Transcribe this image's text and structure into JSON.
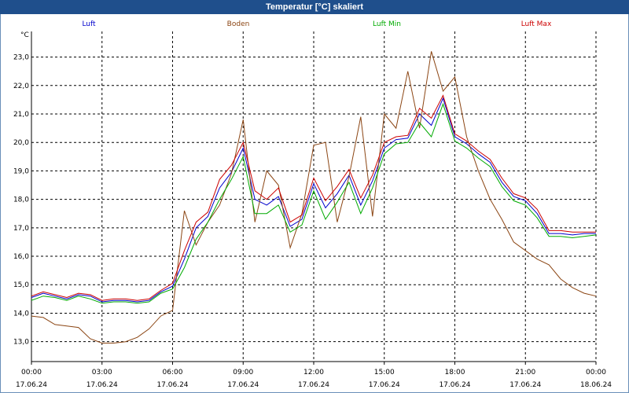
{
  "window": {
    "title": "Temperatur [°C] skaliert"
  },
  "chart_data": {
    "type": "line",
    "title": "Temperatur [°C] skaliert",
    "ylabel": "°C",
    "xlabel": "",
    "ylim": [
      12.3,
      23.9
    ],
    "yticks": [
      13.0,
      14.0,
      15.0,
      16.0,
      17.0,
      18.0,
      19.0,
      20.0,
      21.0,
      22.0,
      23.0
    ],
    "ytick_labels": [
      "13,0",
      "14,0",
      "15,0",
      "16,0",
      "17,0",
      "18,0",
      "19,0",
      "20,0",
      "21,0",
      "22,0",
      "23,0"
    ],
    "xlim": [
      0,
      24
    ],
    "xticks": [
      0,
      3,
      6,
      9,
      12,
      15,
      18,
      21,
      24
    ],
    "xtick_labels": [
      [
        "00:00",
        "17.06.24"
      ],
      [
        "03:00",
        "17.06.24"
      ],
      [
        "06:00",
        "17.06.24"
      ],
      [
        "09:00",
        "17.06.24"
      ],
      [
        "12:00",
        "17.06.24"
      ],
      [
        "15:00",
        "17.06.24"
      ],
      [
        "18:00",
        "17.06.24"
      ],
      [
        "21:00",
        "17.06.24"
      ],
      [
        "00:00",
        "18.06.24"
      ]
    ],
    "grid": true,
    "legend_position": "top",
    "x": [
      0,
      0.5,
      1,
      1.5,
      2,
      2.5,
      3,
      3.5,
      4,
      4.5,
      5,
      5.5,
      6,
      6.5,
      7,
      7.5,
      8,
      8.5,
      9,
      9.5,
      10,
      10.5,
      11,
      11.5,
      12,
      12.5,
      13,
      13.5,
      14,
      14.5,
      15,
      15.5,
      16,
      16.5,
      17,
      17.5,
      18,
      18.5,
      19,
      19.5,
      20,
      20.5,
      21,
      21.5,
      22,
      22.5,
      23,
      23.5,
      24
    ],
    "series": [
      {
        "name": "Luft",
        "color": "#0000cc",
        "values": [
          14.55,
          14.7,
          14.6,
          14.5,
          14.65,
          14.6,
          14.4,
          14.45,
          14.45,
          14.4,
          14.45,
          14.75,
          14.95,
          15.9,
          17.0,
          17.4,
          18.4,
          18.95,
          19.8,
          18.0,
          17.8,
          18.1,
          17.05,
          17.3,
          18.55,
          17.7,
          18.2,
          18.85,
          17.8,
          18.65,
          19.8,
          20.1,
          20.15,
          21.0,
          20.6,
          21.55,
          20.2,
          19.95,
          19.6,
          19.3,
          18.6,
          18.1,
          17.95,
          17.5,
          16.8,
          16.8,
          16.75,
          16.8,
          16.8
        ]
      },
      {
        "name": "Boden",
        "color": "#8b4513",
        "values": [
          13.9,
          13.85,
          13.6,
          13.55,
          13.5,
          13.1,
          12.95,
          12.95,
          13.0,
          13.15,
          13.45,
          13.9,
          14.1,
          17.6,
          16.4,
          17.2,
          17.8,
          18.9,
          20.8,
          17.2,
          19.0,
          18.5,
          16.3,
          17.5,
          19.9,
          20.0,
          17.2,
          18.8,
          20.9,
          17.4,
          21.0,
          20.5,
          22.5,
          20.5,
          23.2,
          21.8,
          22.3,
          20.2,
          19.0,
          18.0,
          17.3,
          16.5,
          16.2,
          15.9,
          15.7,
          15.2,
          14.9,
          14.7,
          14.6
        ]
      },
      {
        "name": "Luft Min",
        "color": "#00aa00",
        "values": [
          14.45,
          14.6,
          14.55,
          14.45,
          14.6,
          14.5,
          14.35,
          14.4,
          14.4,
          14.35,
          14.4,
          14.7,
          14.85,
          15.6,
          16.6,
          17.2,
          18.0,
          18.7,
          19.5,
          17.5,
          17.5,
          17.8,
          16.85,
          17.1,
          18.3,
          17.3,
          17.9,
          18.6,
          17.5,
          18.4,
          19.6,
          19.95,
          20.0,
          20.7,
          20.2,
          21.35,
          20.05,
          19.8,
          19.45,
          19.15,
          18.45,
          17.95,
          17.8,
          17.35,
          16.7,
          16.7,
          16.65,
          16.7,
          16.75
        ]
      },
      {
        "name": "Luft Max",
        "color": "#cc0000",
        "values": [
          14.6,
          14.75,
          14.65,
          14.55,
          14.7,
          14.65,
          14.45,
          14.5,
          14.5,
          14.45,
          14.5,
          14.8,
          15.05,
          16.2,
          17.2,
          17.55,
          18.7,
          19.2,
          20.0,
          18.3,
          18.0,
          18.4,
          17.2,
          17.45,
          18.75,
          17.95,
          18.45,
          19.05,
          18.05,
          18.85,
          20.0,
          20.2,
          20.25,
          21.2,
          20.85,
          21.65,
          20.3,
          20.05,
          19.7,
          19.4,
          18.75,
          18.2,
          18.05,
          17.65,
          16.9,
          16.9,
          16.85,
          16.85,
          16.85
        ]
      }
    ]
  }
}
